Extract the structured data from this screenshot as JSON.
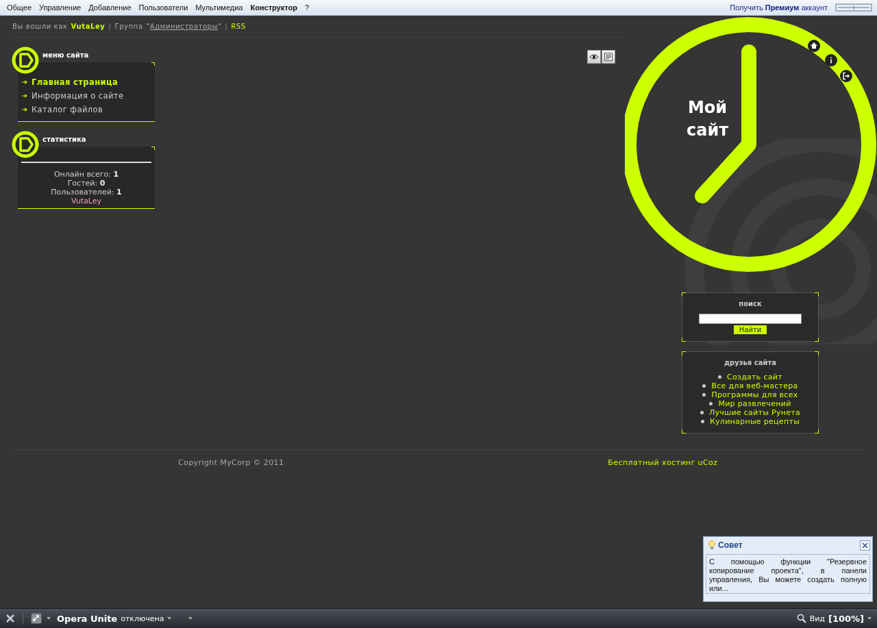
{
  "top_menu": {
    "items": [
      {
        "label": "Общее",
        "selected": false
      },
      {
        "label": "Управление",
        "selected": false
      },
      {
        "label": "Добавление",
        "selected": false
      },
      {
        "label": "Пользователи",
        "selected": false
      },
      {
        "label": "Мультимедиа",
        "selected": false
      },
      {
        "label": "Конструктор",
        "selected": true
      },
      {
        "label": "?",
        "selected": false
      }
    ],
    "premium": "Получить **Премиум** аккаунт"
  },
  "user_bar": {
    "greeting": "Вы вошли как",
    "user": "VutaLey",
    "separators": [
      "|",
      "|"
    ],
    "group_label": "Группа",
    "quote_open": "\"",
    "group_link": "Администраторы",
    "quote_close": "\"",
    "rss": "RSS"
  },
  "left_blocks": [
    {
      "kind": "menu",
      "title": "меню сайта",
      "items": [
        {
          "label": "Главная страница",
          "selected": true
        },
        {
          "label": "Информация о сайте",
          "selected": false
        },
        {
          "label": "Каталог файлов",
          "selected": false
        }
      ]
    },
    {
      "kind": "stats",
      "title": "статистика",
      "lines": [
        "Онлайн всего: **1**",
        "Гостей: **0**",
        "Пользователей: **1**"
      ],
      "user": "VutaLey"
    }
  ],
  "logo": {
    "line1": "Мой",
    "line2": "сайт"
  },
  "search": {
    "title": "поиск",
    "button": "Найти"
  },
  "friends": {
    "title": "друзья сайта",
    "links": [
      "Создать сайт",
      "Все для веб-мастера",
      "Программы для всех",
      "Мир развлечений",
      "Лучшие сайты Рунета",
      "Кулинарные рецепты"
    ]
  },
  "footer": {
    "copyright": "Copyright MyCorp © 2011",
    "hosting": "Бесплатный хостинг uCoz"
  },
  "tip": {
    "title": "Совет",
    "text": "С помощью функции \"Резервное копирование проекта\", в панели управления, Вы можете создать полную или..."
  },
  "status_bar": {
    "unite": "Opera Unite",
    "unite_state": "отключена",
    "view": "Вид",
    "zoom": "[100%]"
  }
}
